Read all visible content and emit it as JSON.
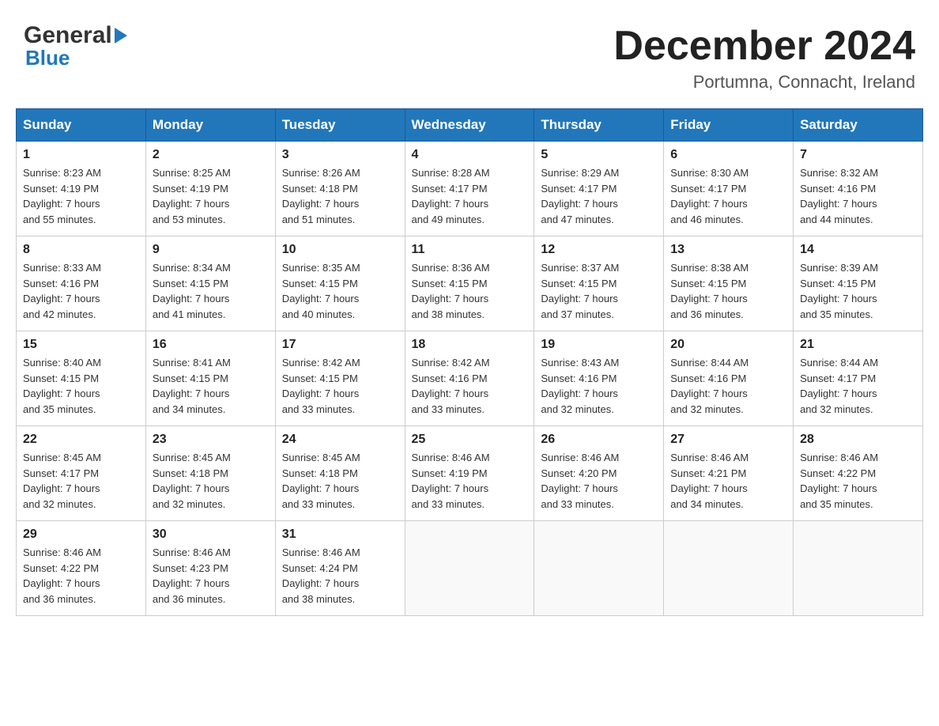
{
  "logo": {
    "general": "General",
    "blue": "Blue"
  },
  "header": {
    "title": "December 2024",
    "subtitle": "Portumna, Connacht, Ireland"
  },
  "weekdays": [
    "Sunday",
    "Monday",
    "Tuesday",
    "Wednesday",
    "Thursday",
    "Friday",
    "Saturday"
  ],
  "weeks": [
    [
      {
        "day": "1",
        "sunrise": "Sunrise: 8:23 AM",
        "sunset": "Sunset: 4:19 PM",
        "daylight": "Daylight: 7 hours",
        "daylight2": "and 55 minutes."
      },
      {
        "day": "2",
        "sunrise": "Sunrise: 8:25 AM",
        "sunset": "Sunset: 4:19 PM",
        "daylight": "Daylight: 7 hours",
        "daylight2": "and 53 minutes."
      },
      {
        "day": "3",
        "sunrise": "Sunrise: 8:26 AM",
        "sunset": "Sunset: 4:18 PM",
        "daylight": "Daylight: 7 hours",
        "daylight2": "and 51 minutes."
      },
      {
        "day": "4",
        "sunrise": "Sunrise: 8:28 AM",
        "sunset": "Sunset: 4:17 PM",
        "daylight": "Daylight: 7 hours",
        "daylight2": "and 49 minutes."
      },
      {
        "day": "5",
        "sunrise": "Sunrise: 8:29 AM",
        "sunset": "Sunset: 4:17 PM",
        "daylight": "Daylight: 7 hours",
        "daylight2": "and 47 minutes."
      },
      {
        "day": "6",
        "sunrise": "Sunrise: 8:30 AM",
        "sunset": "Sunset: 4:17 PM",
        "daylight": "Daylight: 7 hours",
        "daylight2": "and 46 minutes."
      },
      {
        "day": "7",
        "sunrise": "Sunrise: 8:32 AM",
        "sunset": "Sunset: 4:16 PM",
        "daylight": "Daylight: 7 hours",
        "daylight2": "and 44 minutes."
      }
    ],
    [
      {
        "day": "8",
        "sunrise": "Sunrise: 8:33 AM",
        "sunset": "Sunset: 4:16 PM",
        "daylight": "Daylight: 7 hours",
        "daylight2": "and 42 minutes."
      },
      {
        "day": "9",
        "sunrise": "Sunrise: 8:34 AM",
        "sunset": "Sunset: 4:15 PM",
        "daylight": "Daylight: 7 hours",
        "daylight2": "and 41 minutes."
      },
      {
        "day": "10",
        "sunrise": "Sunrise: 8:35 AM",
        "sunset": "Sunset: 4:15 PM",
        "daylight": "Daylight: 7 hours",
        "daylight2": "and 40 minutes."
      },
      {
        "day": "11",
        "sunrise": "Sunrise: 8:36 AM",
        "sunset": "Sunset: 4:15 PM",
        "daylight": "Daylight: 7 hours",
        "daylight2": "and 38 minutes."
      },
      {
        "day": "12",
        "sunrise": "Sunrise: 8:37 AM",
        "sunset": "Sunset: 4:15 PM",
        "daylight": "Daylight: 7 hours",
        "daylight2": "and 37 minutes."
      },
      {
        "day": "13",
        "sunrise": "Sunrise: 8:38 AM",
        "sunset": "Sunset: 4:15 PM",
        "daylight": "Daylight: 7 hours",
        "daylight2": "and 36 minutes."
      },
      {
        "day": "14",
        "sunrise": "Sunrise: 8:39 AM",
        "sunset": "Sunset: 4:15 PM",
        "daylight": "Daylight: 7 hours",
        "daylight2": "and 35 minutes."
      }
    ],
    [
      {
        "day": "15",
        "sunrise": "Sunrise: 8:40 AM",
        "sunset": "Sunset: 4:15 PM",
        "daylight": "Daylight: 7 hours",
        "daylight2": "and 35 minutes."
      },
      {
        "day": "16",
        "sunrise": "Sunrise: 8:41 AM",
        "sunset": "Sunset: 4:15 PM",
        "daylight": "Daylight: 7 hours",
        "daylight2": "and 34 minutes."
      },
      {
        "day": "17",
        "sunrise": "Sunrise: 8:42 AM",
        "sunset": "Sunset: 4:15 PM",
        "daylight": "Daylight: 7 hours",
        "daylight2": "and 33 minutes."
      },
      {
        "day": "18",
        "sunrise": "Sunrise: 8:42 AM",
        "sunset": "Sunset: 4:16 PM",
        "daylight": "Daylight: 7 hours",
        "daylight2": "and 33 minutes."
      },
      {
        "day": "19",
        "sunrise": "Sunrise: 8:43 AM",
        "sunset": "Sunset: 4:16 PM",
        "daylight": "Daylight: 7 hours",
        "daylight2": "and 32 minutes."
      },
      {
        "day": "20",
        "sunrise": "Sunrise: 8:44 AM",
        "sunset": "Sunset: 4:16 PM",
        "daylight": "Daylight: 7 hours",
        "daylight2": "and 32 minutes."
      },
      {
        "day": "21",
        "sunrise": "Sunrise: 8:44 AM",
        "sunset": "Sunset: 4:17 PM",
        "daylight": "Daylight: 7 hours",
        "daylight2": "and 32 minutes."
      }
    ],
    [
      {
        "day": "22",
        "sunrise": "Sunrise: 8:45 AM",
        "sunset": "Sunset: 4:17 PM",
        "daylight": "Daylight: 7 hours",
        "daylight2": "and 32 minutes."
      },
      {
        "day": "23",
        "sunrise": "Sunrise: 8:45 AM",
        "sunset": "Sunset: 4:18 PM",
        "daylight": "Daylight: 7 hours",
        "daylight2": "and 32 minutes."
      },
      {
        "day": "24",
        "sunrise": "Sunrise: 8:45 AM",
        "sunset": "Sunset: 4:18 PM",
        "daylight": "Daylight: 7 hours",
        "daylight2": "and 33 minutes."
      },
      {
        "day": "25",
        "sunrise": "Sunrise: 8:46 AM",
        "sunset": "Sunset: 4:19 PM",
        "daylight": "Daylight: 7 hours",
        "daylight2": "and 33 minutes."
      },
      {
        "day": "26",
        "sunrise": "Sunrise: 8:46 AM",
        "sunset": "Sunset: 4:20 PM",
        "daylight": "Daylight: 7 hours",
        "daylight2": "and 33 minutes."
      },
      {
        "day": "27",
        "sunrise": "Sunrise: 8:46 AM",
        "sunset": "Sunset: 4:21 PM",
        "daylight": "Daylight: 7 hours",
        "daylight2": "and 34 minutes."
      },
      {
        "day": "28",
        "sunrise": "Sunrise: 8:46 AM",
        "sunset": "Sunset: 4:22 PM",
        "daylight": "Daylight: 7 hours",
        "daylight2": "and 35 minutes."
      }
    ],
    [
      {
        "day": "29",
        "sunrise": "Sunrise: 8:46 AM",
        "sunset": "Sunset: 4:22 PM",
        "daylight": "Daylight: 7 hours",
        "daylight2": "and 36 minutes."
      },
      {
        "day": "30",
        "sunrise": "Sunrise: 8:46 AM",
        "sunset": "Sunset: 4:23 PM",
        "daylight": "Daylight: 7 hours",
        "daylight2": "and 36 minutes."
      },
      {
        "day": "31",
        "sunrise": "Sunrise: 8:46 AM",
        "sunset": "Sunset: 4:24 PM",
        "daylight": "Daylight: 7 hours",
        "daylight2": "and 38 minutes."
      },
      null,
      null,
      null,
      null
    ]
  ]
}
